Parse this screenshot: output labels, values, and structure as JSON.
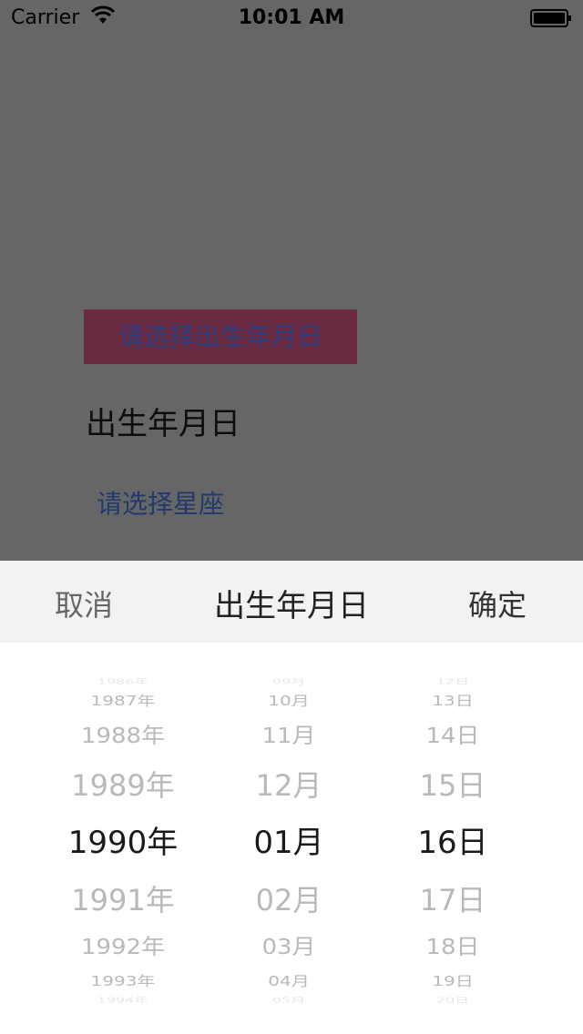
{
  "status_bar": {
    "carrier": "Carrier",
    "time": "10:01 AM"
  },
  "background_page": {
    "birth_button_label": "请选择出生年月日",
    "birth_label": "出生年月日",
    "zodiac_button_label": "请选择星座"
  },
  "picker": {
    "cancel_label": "取消",
    "title": "出生年月日",
    "confirm_label": "确定",
    "columns": [
      {
        "items": [
          "1986年",
          "1987年",
          "1988年",
          "1989年",
          "1990年",
          "1991年",
          "1992年",
          "1993年",
          "1994年"
        ],
        "selected": "1990年"
      },
      {
        "items": [
          "09月",
          "10月",
          "11月",
          "12月",
          "01月",
          "02月",
          "03月",
          "04月",
          "05月"
        ],
        "selected": "01月"
      },
      {
        "items": [
          "12日",
          "13日",
          "14日",
          "15日",
          "16日",
          "17日",
          "18日",
          "19日",
          "20日"
        ],
        "selected": "16日"
      }
    ]
  }
}
